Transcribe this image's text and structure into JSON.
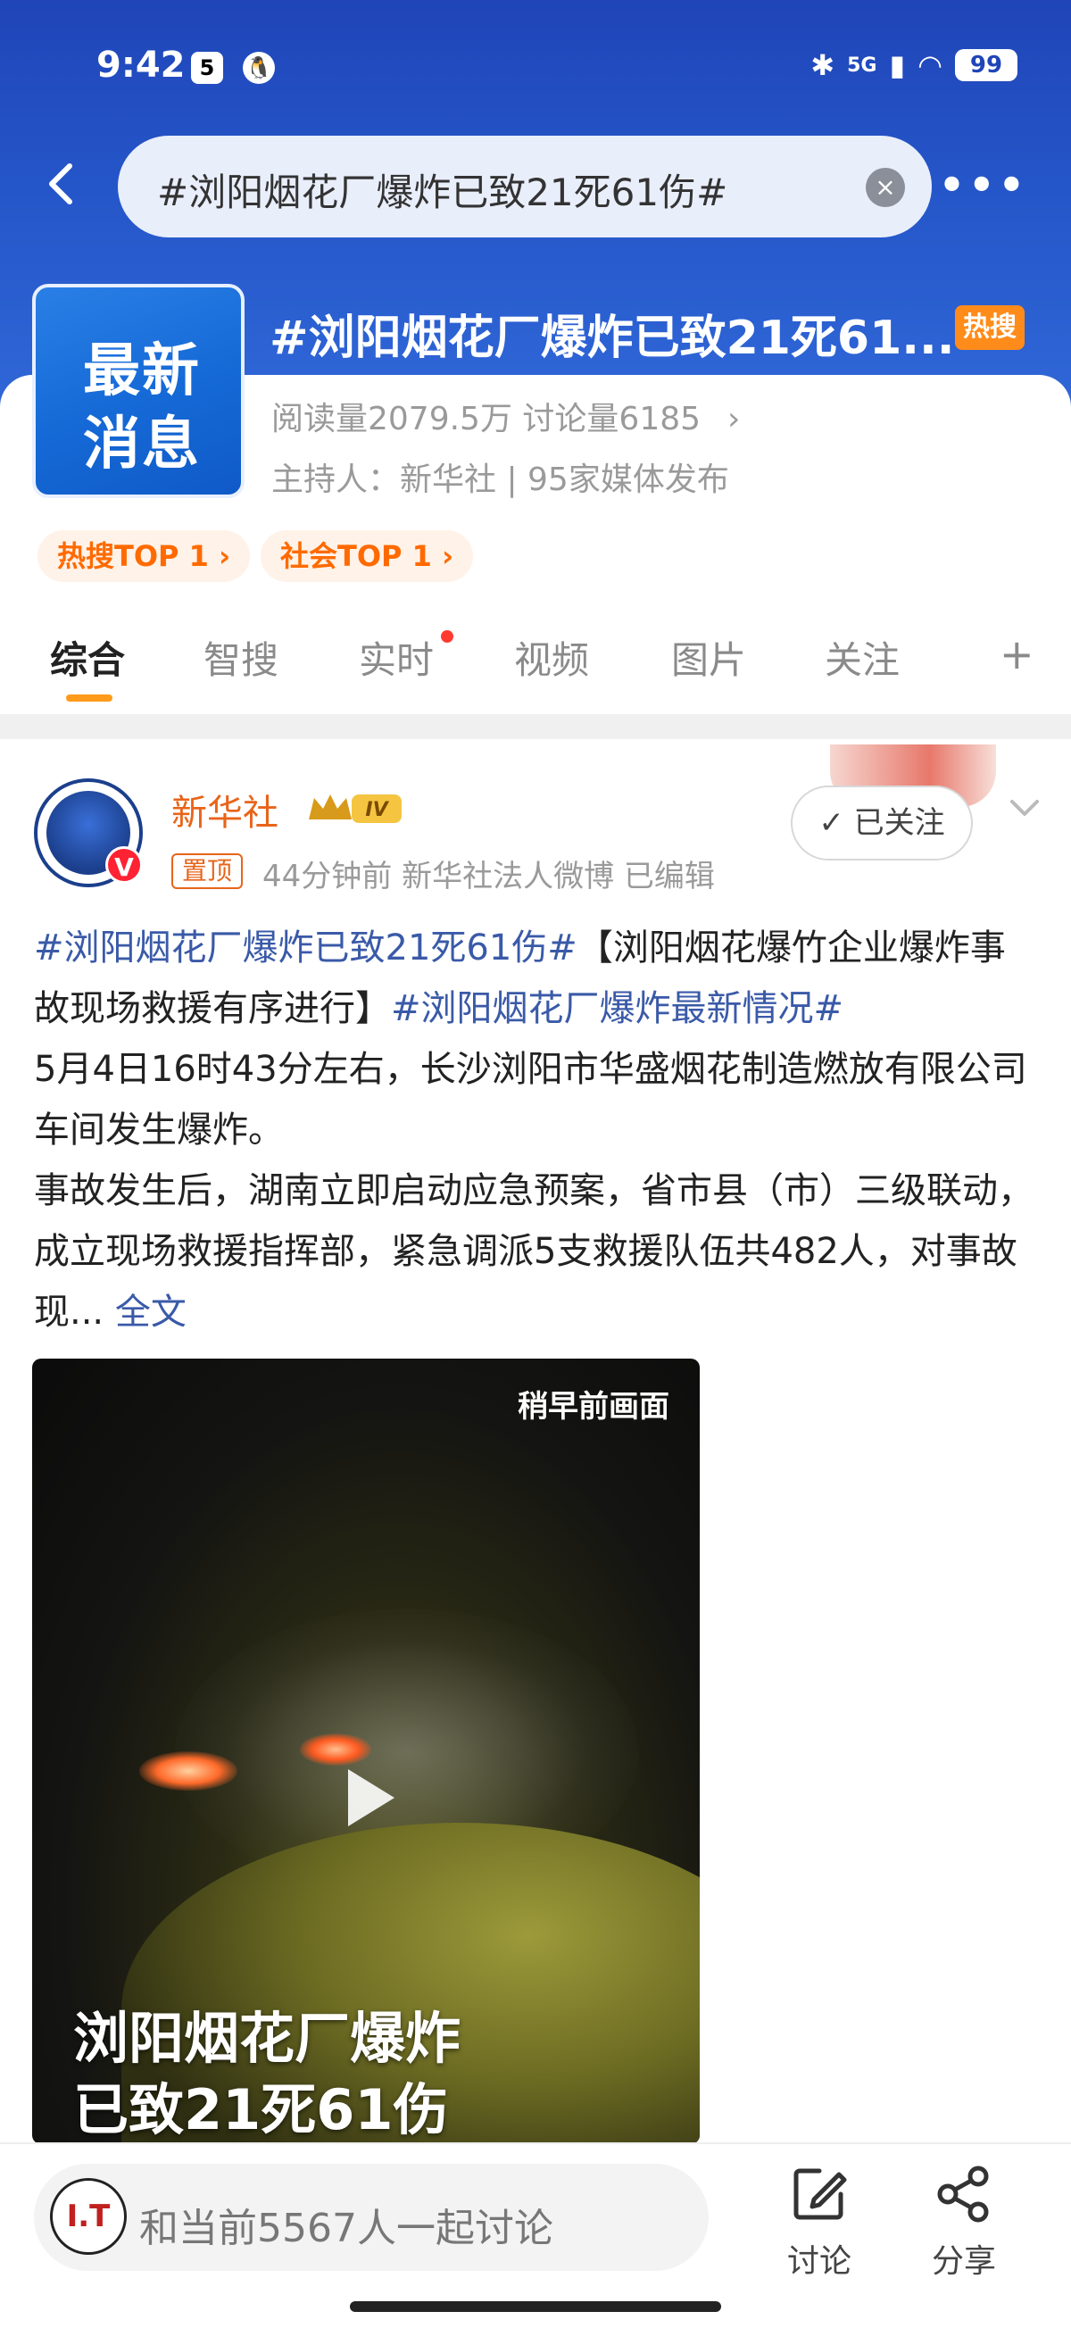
{
  "status_bar": {
    "time": "9:42",
    "notif_1": "5",
    "network": "5G",
    "battery": "99"
  },
  "search": {
    "query": "#浏阳烟花厂爆炸已致21死61伤#"
  },
  "topic": {
    "logo_line_1": "最新",
    "logo_line_2": "消息",
    "title": "#浏阳烟花厂爆炸已致21死61...",
    "hot_badge": "热搜",
    "stats": "阅读量2079.5万  讨论量6185",
    "host": "主持人：新华社 | 95家媒体发布",
    "chips": [
      "热搜TOP 1 ›",
      "社会TOP 1 ›"
    ]
  },
  "tabs": [
    "综合",
    "智搜",
    "实时",
    "视频",
    "图片",
    "关注",
    "+"
  ],
  "post": {
    "author": "新华社",
    "level": "IV",
    "pinned": "置顶",
    "meta": "44分钟前  新华社法人微博  已编辑",
    "follow_label": "✓ 已关注",
    "tag_1": "#浏阳烟花厂爆炸已致21死61伤#",
    "headline": "【浏阳烟花爆竹企业爆炸事故现场救援有序进行】",
    "tag_2": "#浏阳烟花厂爆炸最新情况#",
    "body_1": "5月4日16时43分左右，长沙浏阳市华盛烟花制造燃放有限公司车间发生爆炸。",
    "body_2": "事故发生后，湖南立即启动应急预案，省市县（市）三级联动，成立现场救援指挥部，紧急调派5支救援队伍共482人，对事故现...",
    "full_text": "全文",
    "video": {
      "tag": "稍早前画面",
      "caption_1": "浏阳烟花厂爆炸",
      "caption_2": "已致21死61伤"
    }
  },
  "bottom_bar": {
    "user_avatar_text": "I.T",
    "comment_placeholder": "和当前5567人一起讨论",
    "discuss_label": "讨论",
    "share_label": "分享"
  },
  "colors": {
    "header_blue": "#2556c9",
    "accent_orange": "#ff8c1a",
    "link_blue": "#3a5aa8",
    "author_orange": "#e8641a"
  }
}
